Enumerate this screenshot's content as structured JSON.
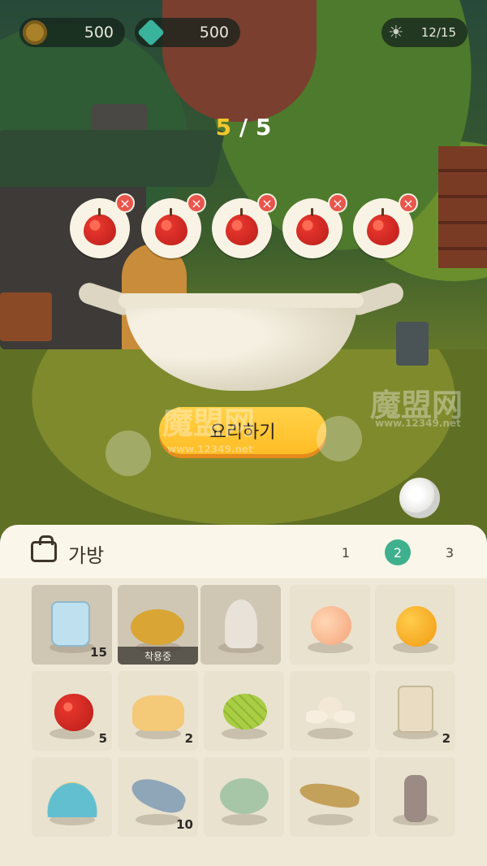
{
  "hud": {
    "coins": "500",
    "gems": "500",
    "energy": "12/15",
    "coin_icon": "coin-icon",
    "gem_icon": "gem-icon",
    "energy_icon": "sun-icon"
  },
  "cooking": {
    "count_current": "5",
    "count_separator": " / ",
    "count_max": "5",
    "slots": [
      {
        "item": "apple",
        "icon": "apple-icon"
      },
      {
        "item": "apple",
        "icon": "apple-icon"
      },
      {
        "item": "apple",
        "icon": "apple-icon"
      },
      {
        "item": "apple",
        "icon": "apple-icon"
      },
      {
        "item": "apple",
        "icon": "apple-icon"
      }
    ],
    "remove_glyph": "×",
    "cook_button": "요리하기"
  },
  "watermark": {
    "logo_text": "魔盟网",
    "url_text": "www.12349.net"
  },
  "bag": {
    "title": "가방",
    "pages": [
      "1",
      "2",
      "3"
    ],
    "active_page": 2,
    "equipped_label": "착용중",
    "items": [
      {
        "name": "plastic-bag",
        "qty": "15"
      },
      {
        "name": "chick",
        "qty": "",
        "equipped": true
      },
      {
        "name": "stone-figure",
        "qty": ""
      },
      {
        "name": "peach",
        "qty": ""
      },
      {
        "name": "orange",
        "qty": ""
      },
      {
        "name": "apple",
        "qty": "5"
      },
      {
        "name": "chick-buns",
        "qty": "2"
      },
      {
        "name": "melon-bread",
        "qty": ""
      },
      {
        "name": "eggs",
        "qty": ""
      },
      {
        "name": "flour",
        "qty": "2"
      },
      {
        "name": "pudding",
        "qty": ""
      },
      {
        "name": "fish",
        "qty": "10"
      },
      {
        "name": "pufferfish",
        "qty": ""
      },
      {
        "name": "salmon",
        "qty": ""
      },
      {
        "name": "grilled-skewer",
        "qty": ""
      }
    ]
  },
  "colors": {
    "accent_yellow": "#f7c52e",
    "cook_button": "#ffbd25",
    "active_tab": "#3fb08e",
    "remove_badge": "#e9554c",
    "panel_bg": "#fbf6ea"
  }
}
